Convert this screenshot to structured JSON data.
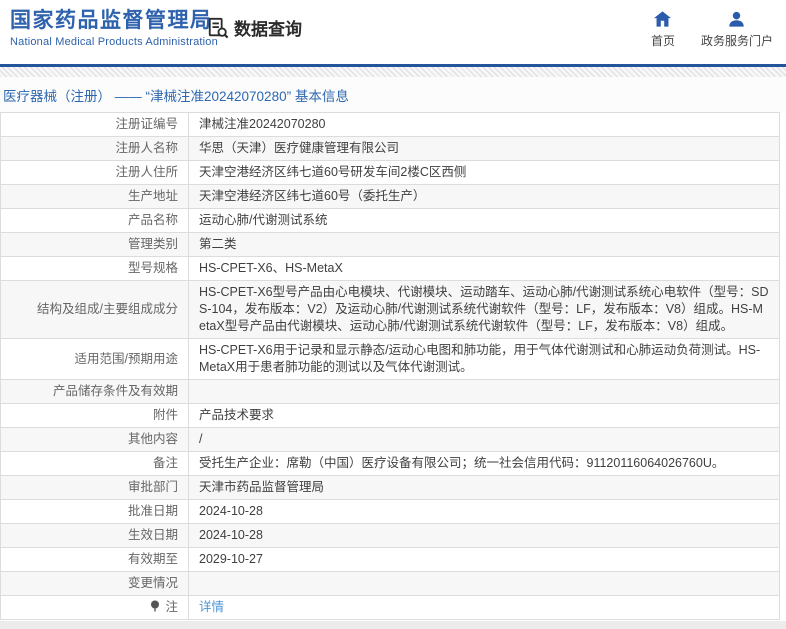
{
  "header": {
    "title": "国家药品监督管理局",
    "subtitle": "National Medical Products Administration",
    "nav_query_label": "数据查询",
    "home_label": "首页",
    "portal_label": "政务服务门户"
  },
  "breadcrumb": {
    "text": "医疗器械（注册） —— “津械注准20242070280” 基本信息"
  },
  "table": {
    "rows": [
      {
        "label": "注册证编号",
        "value": "津械注准20242070280"
      },
      {
        "label": "注册人名称",
        "value": "华思（天津）医疗健康管理有限公司"
      },
      {
        "label": "注册人住所",
        "value": "天津空港经济区纬七道60号研发车间2楼C区西侧"
      },
      {
        "label": "生产地址",
        "value": "天津空港经济区纬七道60号（委托生产）"
      },
      {
        "label": "产品名称",
        "value": "运动心肺/代谢测试系统"
      },
      {
        "label": "管理类别",
        "value": "第二类"
      },
      {
        "label": "型号规格",
        "value": "HS-CPET-X6、HS-MetaX"
      },
      {
        "label": "结构及组成/主要组成成分",
        "value": "HS-CPET-X6型号产品由心电模块、代谢模块、运动踏车、运动心肺/代谢测试系统心电软件（型号：SDS-104，发布版本：V2）及运动心肺/代谢测试系统代谢软件（型号：LF，发布版本：V8）组成。HS-MetaX型号产品由代谢模块、运动心肺/代谢测试系统代谢软件（型号：LF，发布版本：V8）组成。"
      },
      {
        "label": "适用范围/预期用途",
        "value": "HS-CPET-X6用于记录和显示静态/运动心电图和肺功能，用于气体代谢测试和心肺运动负荷测试。HS-MetaX用于患者肺功能的测试以及气体代谢测试。"
      },
      {
        "label": "产品储存条件及有效期",
        "value": ""
      },
      {
        "label": "附件",
        "value": "产品技术要求"
      },
      {
        "label": "其他内容",
        "value": "/"
      },
      {
        "label": "备注",
        "value": "受托生产企业：席勒（中国）医疗设备有限公司；统一社会信用代码：91120116064026760U。"
      },
      {
        "label": "审批部门",
        "value": "天津市药品监督管理局"
      },
      {
        "label": "批准日期",
        "value": "2024-10-28"
      },
      {
        "label": "生效日期",
        "value": "2024-10-28"
      },
      {
        "label": "有效期至",
        "value": "2029-10-27"
      },
      {
        "label": "变更情况",
        "value": ""
      },
      {
        "label": "注",
        "value": "详情",
        "link": true,
        "icon": "note-balloon"
      }
    ]
  },
  "colors": {
    "brand_blue": "#2f62ad",
    "divider_blue": "#24549c",
    "icon_blue": "#2a5cab",
    "breadcrumb_blue": "#2e68b1",
    "link_blue": "#4f94d6",
    "table_border": "#dcdcdc",
    "stripe_bg": "#f7f7f7",
    "label_gray": "#666666",
    "value_gray": "#404040"
  }
}
